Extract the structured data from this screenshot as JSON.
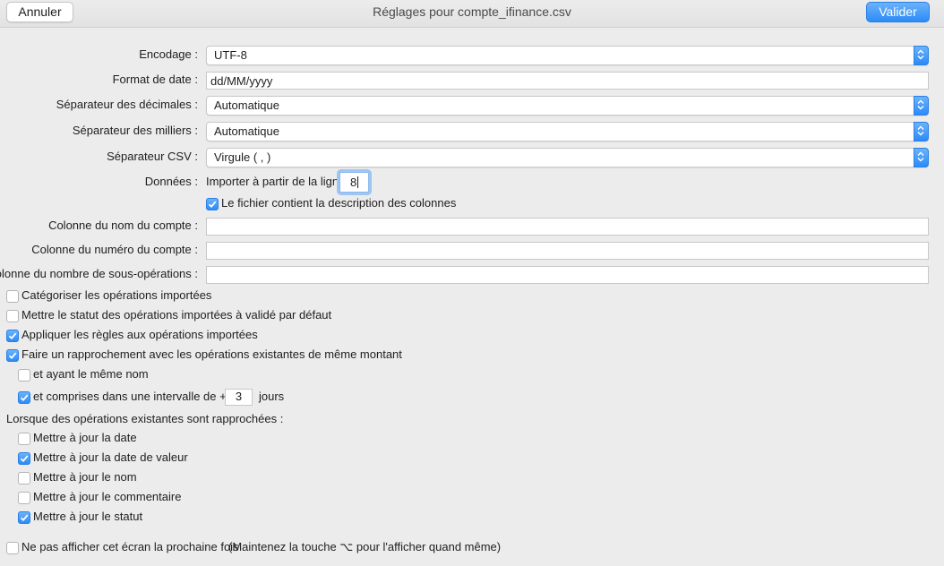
{
  "window": {
    "title": "Réglages pour compte_ifinance.csv",
    "cancel_label": "Annuler",
    "ok_label": "Valider"
  },
  "form": {
    "encoding_label": "Encodage :",
    "encoding_value": "UTF-8",
    "date_format_label": "Format de date :",
    "date_format_value": "dd/MM/yyyy",
    "decimal_sep_label": "Séparateur des décimales :",
    "decimal_sep_value": "Automatique",
    "thousands_sep_label": "Séparateur des milliers :",
    "thousands_sep_value": "Automatique",
    "csv_sep_label": "Séparateur CSV :",
    "csv_sep_value": "Virgule ( , )",
    "data_label": "Données :",
    "import_from_line_label": "Importer à partir de la ligne",
    "import_from_line_value": "8",
    "has_header_label": "Le fichier contient la description des colonnes",
    "has_header_checked": true,
    "account_name_col_label": "Colonne du nom du compte :",
    "account_name_col_value": "",
    "account_number_col_label": "Colonne du numéro du compte :",
    "account_number_col_value": "",
    "sub_ops_col_label": "Colonne du nombre de sous-opérations :",
    "sub_ops_col_value": ""
  },
  "options": {
    "categorize_label": "Catégoriser les opérations importées",
    "categorize_checked": false,
    "validated_label": "Mettre le statut des opérations importées à validé par défaut",
    "validated_checked": false,
    "rules_label": "Appliquer les règles aux opérations importées",
    "rules_checked": true,
    "reconcile_label": "Faire un rapprochement avec les opérations existantes de même montant",
    "reconcile_checked": true,
    "same_name_label": "et ayant le même nom",
    "same_name_checked": false,
    "interval_label": "et comprises dans une intervalle de +/-",
    "interval_checked": true,
    "interval_value": "3",
    "interval_unit": "jours"
  },
  "reconciled": {
    "heading": "Lorsque des opérations existantes sont rapprochées :",
    "update_date_label": "Mettre à jour la date",
    "update_date_checked": false,
    "update_value_date_label": "Mettre à jour la date de valeur",
    "update_value_date_checked": true,
    "update_name_label": "Mettre à jour le nom",
    "update_name_checked": false,
    "update_comment_label": "Mettre à jour le commentaire",
    "update_comment_checked": false,
    "update_status_label": "Mettre à jour le statut",
    "update_status_checked": true
  },
  "footer": {
    "dont_show_label": "Ne pas afficher cet écran la prochaine fois",
    "dont_show_checked": false,
    "hint": "(Maintenez la touche ⌥ pour l'afficher quand même)"
  },
  "colors": {
    "accent": "#2b8bf7",
    "background": "#ececec"
  }
}
